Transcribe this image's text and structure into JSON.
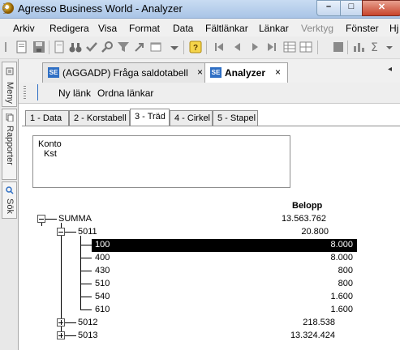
{
  "window": {
    "title": "Agresso Business World - Analyzer"
  },
  "menu": [
    {
      "label": "Arkiv",
      "enabled": true
    },
    {
      "label": "Redigera",
      "enabled": true
    },
    {
      "label": "Visa",
      "enabled": true
    },
    {
      "label": "Format",
      "enabled": true
    },
    {
      "label": "Data",
      "enabled": true
    },
    {
      "label": "Fältlänkar",
      "enabled": true
    },
    {
      "label": "Länkar",
      "enabled": true
    },
    {
      "label": "Verktyg",
      "enabled": false
    },
    {
      "label": "Fönster",
      "enabled": true
    },
    {
      "label": "Hj",
      "enabled": true
    }
  ],
  "side_panel": {
    "tabs": [
      "Meny",
      "Rapporter",
      "Sök"
    ]
  },
  "doc_tabs": [
    {
      "badge": "SE",
      "label": "(AGGADP) Fråga saldotabell",
      "active": false,
      "close": "×"
    },
    {
      "badge": "SE",
      "label": "Analyzer",
      "active": true,
      "close": "×"
    }
  ],
  "tab_scroll_glyph": "◂",
  "inner_toolbar": {
    "links": [
      "Ny länk",
      "Ordna länkar"
    ]
  },
  "view_tabs": [
    {
      "label": "1 - Data",
      "active": false
    },
    {
      "label": "2 - Korstabell",
      "active": false
    },
    {
      "label": "3 - Träd",
      "active": true
    },
    {
      "label": "4 - Cirkel",
      "active": false
    },
    {
      "label": "5 - Stapel",
      "active": false
    }
  ],
  "field_box": {
    "lines": [
      "Konto",
      "Kst"
    ]
  },
  "tree": {
    "column_header": "Belopp",
    "rows": [
      {
        "label": "SUMMA",
        "value": "13.563.762",
        "level": 0,
        "expander": "open",
        "selected": false
      },
      {
        "label": "5011",
        "value": "20.800",
        "level": 1,
        "expander": "open",
        "selected": false
      },
      {
        "label": "100",
        "value": "8.000",
        "level": 2,
        "expander": "none",
        "selected": true
      },
      {
        "label": "400",
        "value": "8.000",
        "level": 2,
        "expander": "none",
        "selected": false
      },
      {
        "label": "430",
        "value": "800",
        "level": 2,
        "expander": "none",
        "selected": false
      },
      {
        "label": "510",
        "value": "800",
        "level": 2,
        "expander": "none",
        "selected": false
      },
      {
        "label": "540",
        "value": "1.600",
        "level": 2,
        "expander": "none",
        "selected": false
      },
      {
        "label": "610",
        "value": "1.600",
        "level": 2,
        "expander": "none",
        "selected": false
      },
      {
        "label": "5012",
        "value": "218.538",
        "level": 1,
        "expander": "closed",
        "selected": false
      },
      {
        "label": "5013",
        "value": "13.324.424",
        "level": 1,
        "expander": "closed",
        "selected": false
      }
    ]
  },
  "colors": {
    "selection": "#000000",
    "selection_text": "#ffffff",
    "badge": "#2f6fc4"
  }
}
